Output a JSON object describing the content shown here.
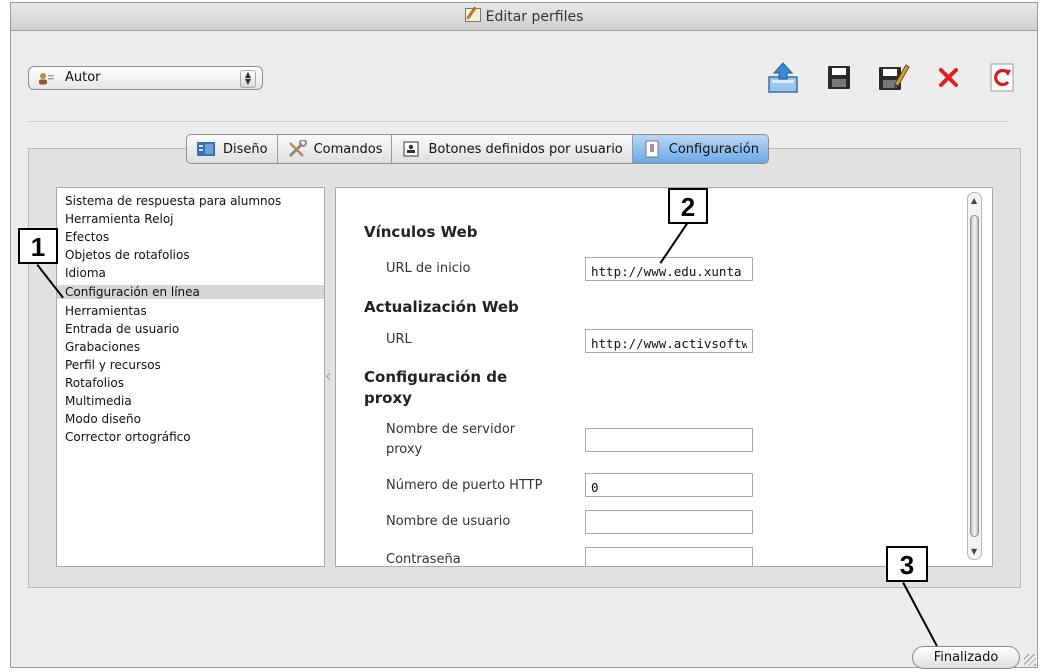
{
  "window": {
    "title": "Editar perfiles"
  },
  "profile_selector": {
    "value": "Autor",
    "icon": "user-icon"
  },
  "toolbar": {
    "buttons": [
      {
        "name": "export-icon"
      },
      {
        "name": "save-icon"
      },
      {
        "name": "edit-icon"
      },
      {
        "name": "delete-icon"
      },
      {
        "name": "refresh-icon"
      }
    ]
  },
  "tabs": [
    {
      "label": "Diseño",
      "active": false
    },
    {
      "label": "Comandos",
      "active": false
    },
    {
      "label": "Botones definidos por usuario",
      "active": false
    },
    {
      "label": "Configuración",
      "active": true
    }
  ],
  "categories": [
    "Sistema de respuesta para alumnos",
    "Herramienta Reloj",
    "Efectos",
    "Objetos de rotafolios",
    "Idioma",
    "Configuración en línea",
    "Herramientas",
    "Entrada de usuario",
    "Grabaciones",
    "Perfil y recursos",
    "Rotafolios",
    "Multimedia",
    "Modo diseño",
    "Corrector ortográfico"
  ],
  "selected_category": "Configuración en línea",
  "settings": {
    "web_links": {
      "heading": "Vínculos Web",
      "start_url_label": "URL de inicio",
      "start_url_value": "http://www.edu.xunta"
    },
    "web_update": {
      "heading": "Actualización Web",
      "url_label": "URL",
      "url_value": "http://www.activsoftw"
    },
    "proxy": {
      "heading_line1": "Configuración de",
      "heading_line2": "proxy",
      "server_label_line1": "Nombre de servidor",
      "server_label_line2": "proxy",
      "server_value": "",
      "port_label": "Número de puerto HTTP",
      "port_value": "0",
      "user_label": "Nombre de usuario",
      "user_value": "",
      "password_label": "Contraseña",
      "password_value": ""
    }
  },
  "done_button": {
    "label": "Finalizado"
  },
  "callouts": [
    "1",
    "2",
    "3"
  ]
}
